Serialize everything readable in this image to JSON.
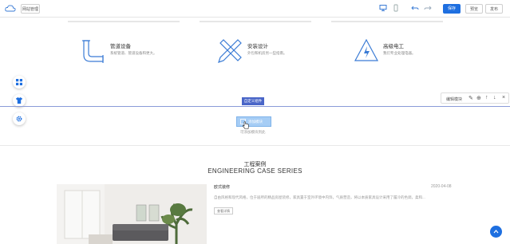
{
  "topbar": {
    "website_manage": "网站管理",
    "preview": "预览",
    "publish": "发布",
    "save": "保存"
  },
  "services": [
    {
      "title": "管道设备",
      "desc": "系统管道、管道设备和更大。"
    },
    {
      "title": "安装设计",
      "desc": "外包和机房另一些指南。"
    },
    {
      "title": "高级电工",
      "desc": "我们专业处理电器。"
    }
  ],
  "editbar": {
    "label": "编辑模块"
  },
  "module": {
    "tag": "自定义组件",
    "add_button": "添加模块",
    "hint": "可添加模块到此"
  },
  "cases": {
    "title": "工程案例",
    "subtitle": "ENGINEERING CASE SERIES",
    "item": {
      "name": "欧式装修",
      "date": "2020-04-08",
      "desc": "自由风格和现代风格，位于居所的精品房屋装修，家具置于室外环境中内饰，气质营造，将以本质家具设计采用了履冷的色调，柔和...",
      "more": "查看详情"
    }
  },
  "colors": {
    "accent": "#1e6fe0",
    "tag": "#4a66c8",
    "add_button": "#a6cdf5",
    "icon_blue": "#3a7bd5"
  }
}
